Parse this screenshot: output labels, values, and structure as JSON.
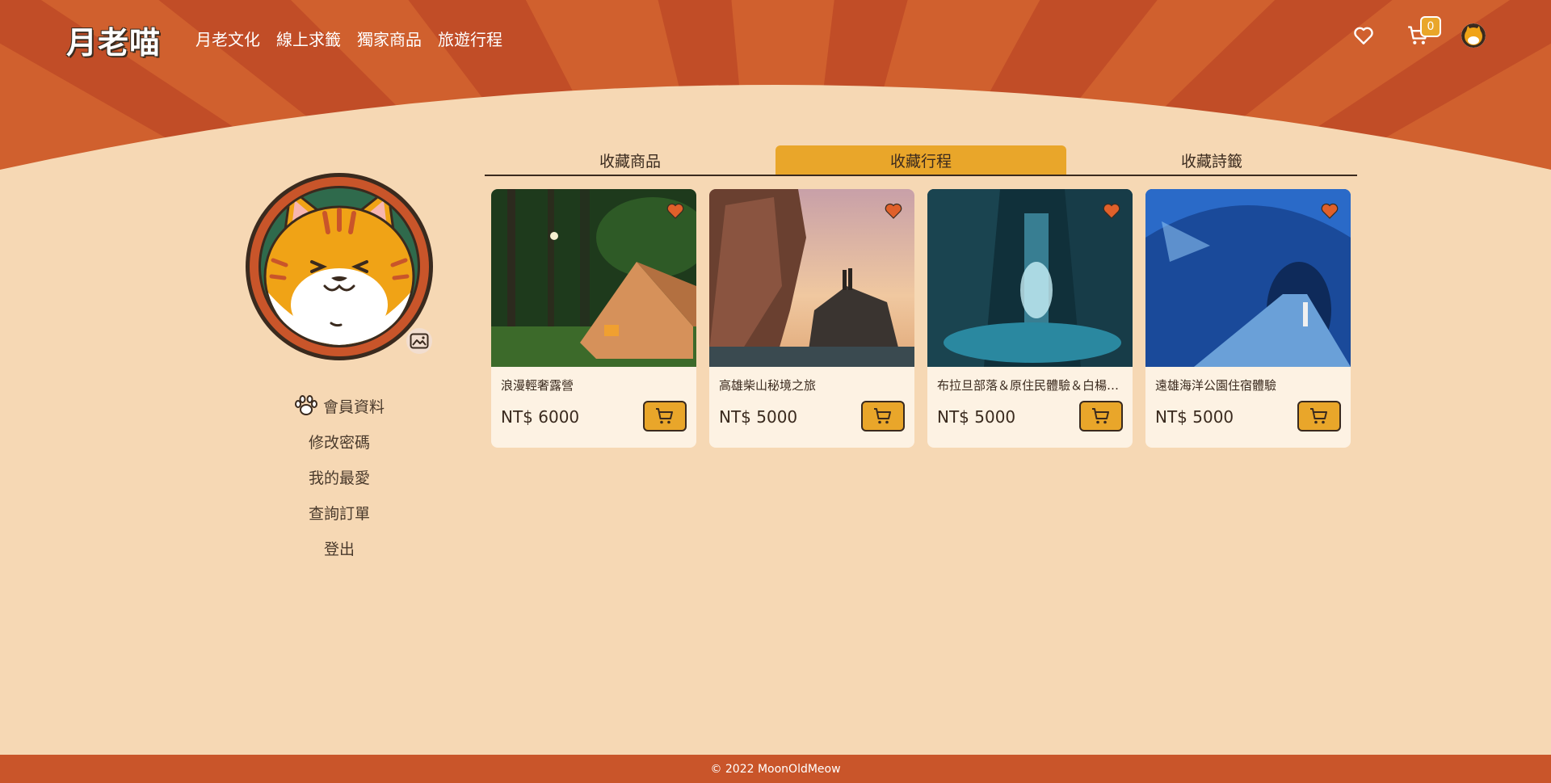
{
  "brand": {
    "logo": "月老喵"
  },
  "nav": {
    "links": [
      "月老文化",
      "線上求籤",
      "獨家商品",
      "旅遊行程"
    ],
    "cart_count": "0",
    "icons": [
      "heart-icon",
      "cart-icon",
      "user-avatar"
    ]
  },
  "sidebar": {
    "items": [
      {
        "label": "會員資料",
        "icon": "paw-icon"
      },
      {
        "label": "修改密碼"
      },
      {
        "label": "我的最愛"
      },
      {
        "label": "查詢訂單"
      },
      {
        "label": "登出"
      }
    ]
  },
  "tabs": [
    {
      "label": "收藏商品",
      "active": false
    },
    {
      "label": "收藏行程",
      "active": true
    },
    {
      "label": "收藏詩籤",
      "active": false
    }
  ],
  "cards": [
    {
      "title": "浪漫輕奢露營",
      "price": "NT$ 6000"
    },
    {
      "title": "高雄柴山秘境之旅",
      "price": "NT$ 5000"
    },
    {
      "title": "布拉旦部落＆原住民體驗＆白楊步道",
      "price": "NT$ 5000"
    },
    {
      "title": "遠雄海洋公園住宿體驗",
      "price": "NT$ 5000"
    }
  ],
  "footer": {
    "text": "© 2022 MoonOldMeow"
  },
  "colors": {
    "background": "#f6d8b4",
    "header_orange": "#c9552a",
    "accent_yellow": "#e9a62a",
    "heart": "#e0602a",
    "card_bg": "#fdf2e3"
  }
}
